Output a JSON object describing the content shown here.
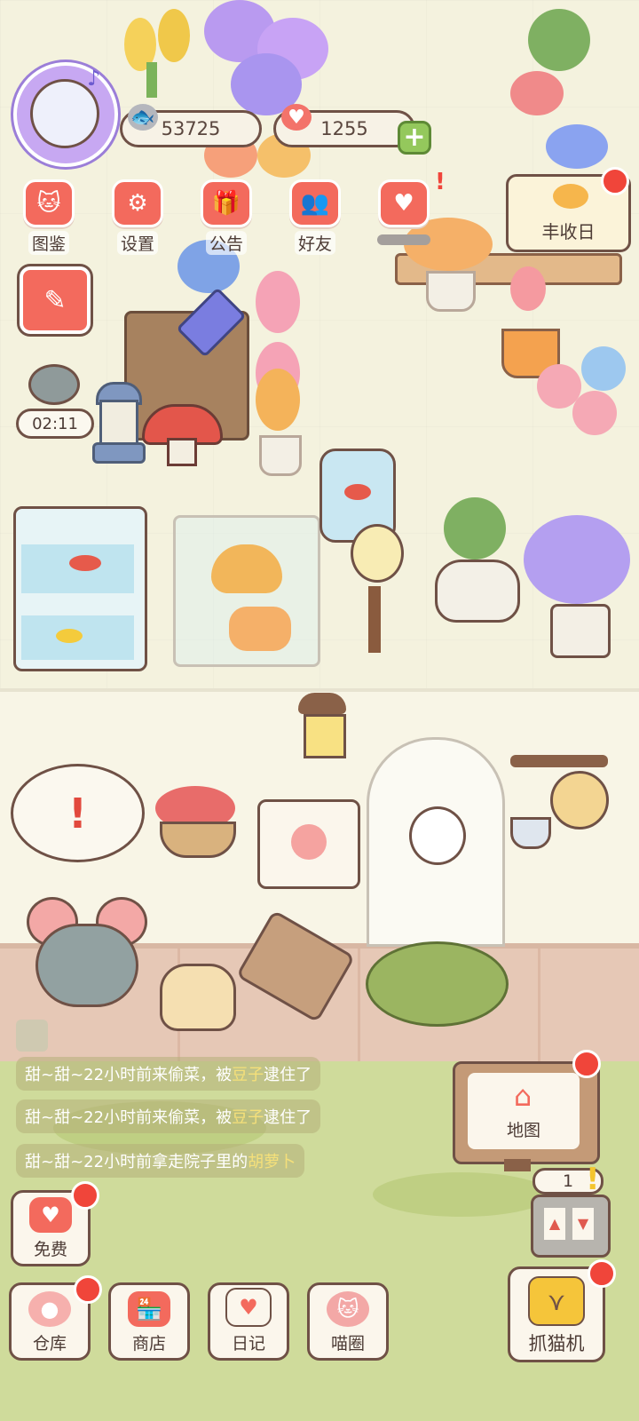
{
  "resources": {
    "fish_count": "53725",
    "heart_count": "1255"
  },
  "menu": [
    {
      "label": "图鉴",
      "icon": "cat-book-icon"
    },
    {
      "label": "设置",
      "icon": "gear-icon"
    },
    {
      "label": "公告",
      "icon": "gift-icon"
    },
    {
      "label": "好友",
      "icon": "friends-icon"
    },
    {
      "label": "",
      "icon": "heart-message-icon"
    }
  ],
  "harvest": {
    "label": "丰收日"
  },
  "timer": {
    "value": "02:11"
  },
  "chat_log": [
    {
      "pre": "甜~甜~22小时前来偷菜，被",
      "hl": "豆子",
      "post": "逮住了"
    },
    {
      "pre": "甜~甜~22小时前来偷菜，被",
      "hl": "豆子",
      "post": "逮住了"
    },
    {
      "pre": "甜~甜~22小时前拿走院子里的",
      "hl": "胡萝卜",
      "post": ""
    }
  ],
  "map_button": {
    "label": "地图"
  },
  "slot_counter": {
    "value": "1"
  },
  "free_button": {
    "label": "免费"
  },
  "bottom_nav": [
    {
      "label": "仓库"
    },
    {
      "label": "商店"
    },
    {
      "label": "日记"
    },
    {
      "label": "喵圈"
    }
  ],
  "claw_machine": {
    "label": "抓猫机"
  },
  "colors": {
    "accent": "#f36a5d",
    "badge": "#f0453a",
    "outline": "#6f5146",
    "grass": "#cfdb9b"
  }
}
